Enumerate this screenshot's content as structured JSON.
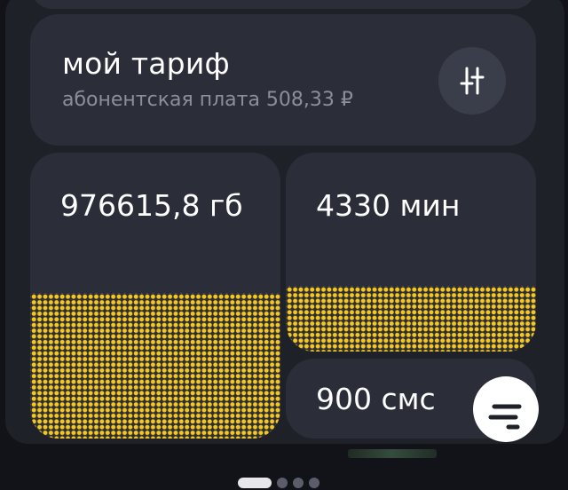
{
  "tariff": {
    "title": "мой тариф",
    "fee": "абонентская плата 508,33 ₽"
  },
  "usage": {
    "internet": {
      "value": "976615,8 гб",
      "fill": 0.51
    },
    "minutes": {
      "value": "4330 мин",
      "fill": 0.33
    },
    "sms": {
      "value": "900 смс"
    }
  },
  "colors": {
    "background": "#121319",
    "card": "#2b2e38",
    "accent_dots": "#f6c71d",
    "secondary_text": "#8b8f9c"
  },
  "icons": {
    "settings": "sliders-icon",
    "chat": "chat-bubble-icon"
  }
}
